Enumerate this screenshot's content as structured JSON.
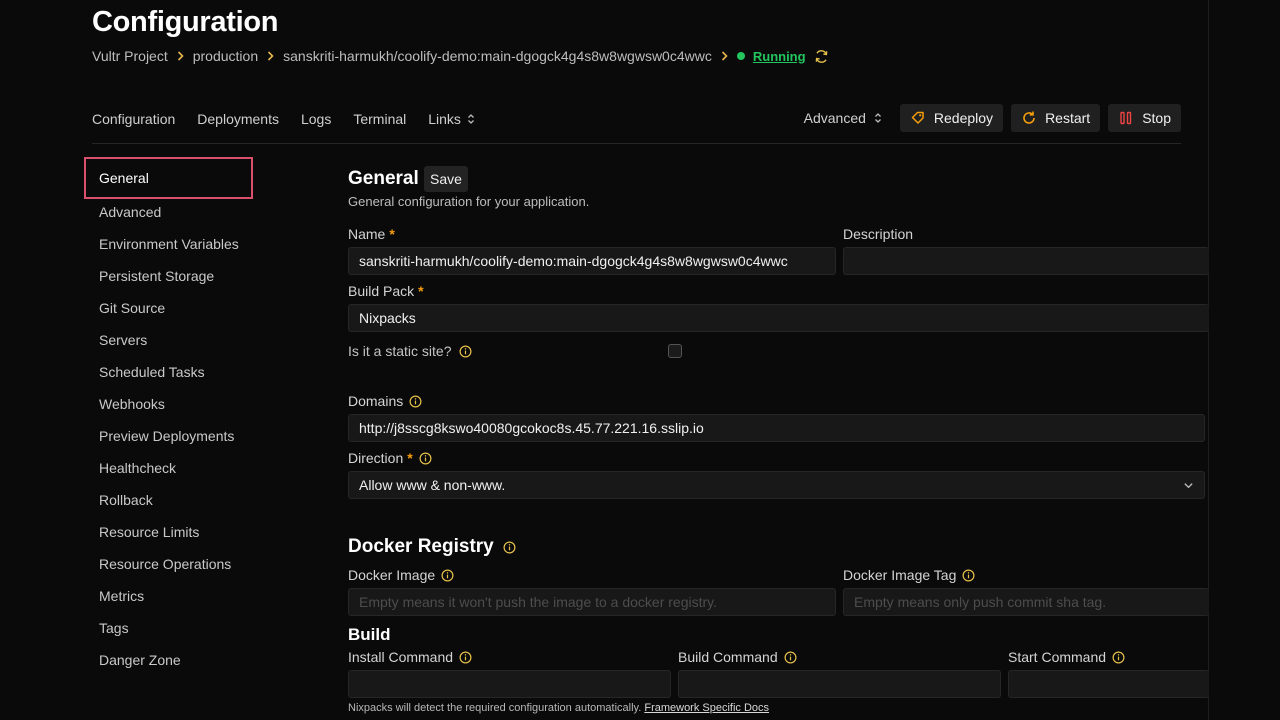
{
  "page": {
    "title": "Configuration"
  },
  "breadcrumb": {
    "project": "Vultr Project",
    "environment": "production",
    "resource": "sanskriti-harmukh/coolify-demo:main-dgogck4g4s8w8wgwsw0c4wwc",
    "status": "Running",
    "status_color": "#22c55e"
  },
  "nav": {
    "tabs": [
      "Configuration",
      "Deployments",
      "Logs",
      "Terminal",
      "Links"
    ],
    "advanced_label": "Advanced",
    "redeploy_label": "Redeploy",
    "restart_label": "Restart",
    "stop_label": "Stop"
  },
  "sidebar": {
    "items": [
      "General",
      "Advanced",
      "Environment Variables",
      "Persistent Storage",
      "Git Source",
      "Servers",
      "Scheduled Tasks",
      "Webhooks",
      "Preview Deployments",
      "Healthcheck",
      "Rollback",
      "Resource Limits",
      "Resource Operations",
      "Metrics",
      "Tags",
      "Danger Zone"
    ],
    "active": "General",
    "highlight_color": "#d9506b"
  },
  "general": {
    "title": "General",
    "save_label": "Save",
    "subtitle": "General configuration for your application.",
    "name_label": "Name",
    "name_value": "sanskriti-harmukh/coolify-demo:main-dgogck4g4s8w8wgwsw0c4wwc",
    "description_label": "Description",
    "description_value": "",
    "build_pack_label": "Build Pack",
    "build_pack_value": "Nixpacks",
    "static_site_label": "Is it a static site?",
    "static_site_checked": false,
    "domains_label": "Domains",
    "domains_value": "http://j8sscg8kswo40080gcokoc8s.45.77.221.16.sslip.io",
    "direction_label": "Direction",
    "direction_value": "Allow www & non-www.",
    "required_marker": "*"
  },
  "docker_registry": {
    "title": "Docker Registry",
    "image_label": "Docker Image",
    "image_placeholder": "Empty means it won't push the image to a docker registry.",
    "tag_label": "Docker Image Tag",
    "tag_placeholder": "Empty means only push commit sha tag."
  },
  "build": {
    "title": "Build",
    "install_label": "Install Command",
    "build_label": "Build Command",
    "start_label": "Start Command",
    "note": "Nixpacks will detect the required configuration automatically.",
    "docs_link": "Framework Specific Docs"
  },
  "colors": {
    "accent": "#f59e0b",
    "info_icon": "#e5c04a",
    "stop_icon": "#ef4444",
    "redeploy_icon": "#f59e0b"
  }
}
